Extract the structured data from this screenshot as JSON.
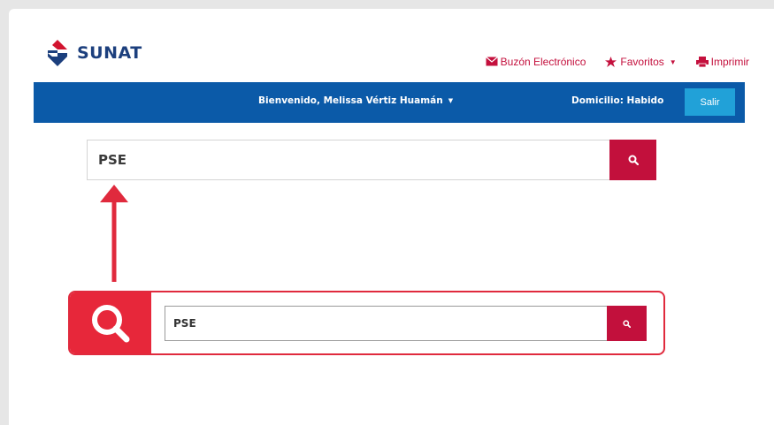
{
  "logo": {
    "text": "SUNAT"
  },
  "toplinks": {
    "buzon": "Buzón Electrónico",
    "favoritos": "Favoritos",
    "imprimir": "Imprimir"
  },
  "navbar": {
    "welcome": "Bienvenido, Melissa Vértiz Huamán",
    "domicilio": "Domicilio: Habido",
    "salir": "Salir"
  },
  "search": {
    "value": "PSE"
  },
  "callout": {
    "value": "PSE"
  },
  "colors": {
    "brand_red": "#c2103c",
    "nav_blue": "#0b5aa8",
    "salir_cyan": "#21a1d8",
    "callout_red": "#e7273a"
  },
  "icons": [
    "envelope-icon",
    "star-icon",
    "printer-icon",
    "search-icon",
    "magnifier-icon",
    "arrow-up-icon"
  ]
}
